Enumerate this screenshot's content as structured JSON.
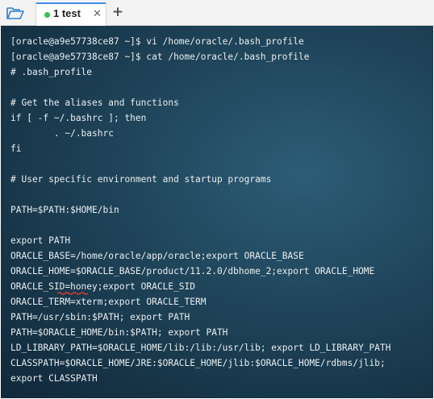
{
  "tabs": [
    {
      "label": "1 test",
      "status_color": "#2ec44b"
    }
  ],
  "terminal": {
    "lines": [
      "[oracle@a9e57738ce87 ~]$ vi /home/oracle/.bash_profile",
      "[oracle@a9e57738ce87 ~]$ cat /home/oracle/.bash_profile",
      "# .bash_profile",
      "",
      "# Get the aliases and functions",
      "if [ -f ~/.bashrc ]; then",
      "        . ~/.bashrc",
      "fi",
      "",
      "# User specific environment and startup programs",
      "",
      "PATH=$PATH:$HOME/bin",
      "",
      "export PATH",
      "ORACLE_BASE=/home/oracle/app/oracle;export ORACLE_BASE",
      "ORACLE_HOME=$ORACLE_BASE/product/11.2.0/dbhome_2;export ORACLE_HOME",
      "ORACLE_SID=honey;export ORACLE_SID",
      "ORACLE_TERM=xterm;export ORACLE_TERM",
      "PATH=/usr/sbin:$PATH; export PATH",
      "PATH=$ORACLE_HOME/bin:$PATH; export PATH",
      "LD_LIBRARY_PATH=$ORACLE_HOME/lib:/lib:/usr/lib; export LD_LIBRARY_PATH",
      "CLASSPATH=$ORACLE_HOME/JRE:$ORACLE_HOME/jlib:$ORACLE_HOME/rdbms/jlib;",
      "export CLASSPATH"
    ]
  },
  "icons": {
    "open_folder": "folder-open-icon",
    "close_tab": "close-icon",
    "new_tab": "plus-icon"
  },
  "glyphs": {
    "close": "✕",
    "add": "+"
  },
  "colors": {
    "tab_accent": "#3c8be0",
    "spell_underline": "#e53935"
  }
}
